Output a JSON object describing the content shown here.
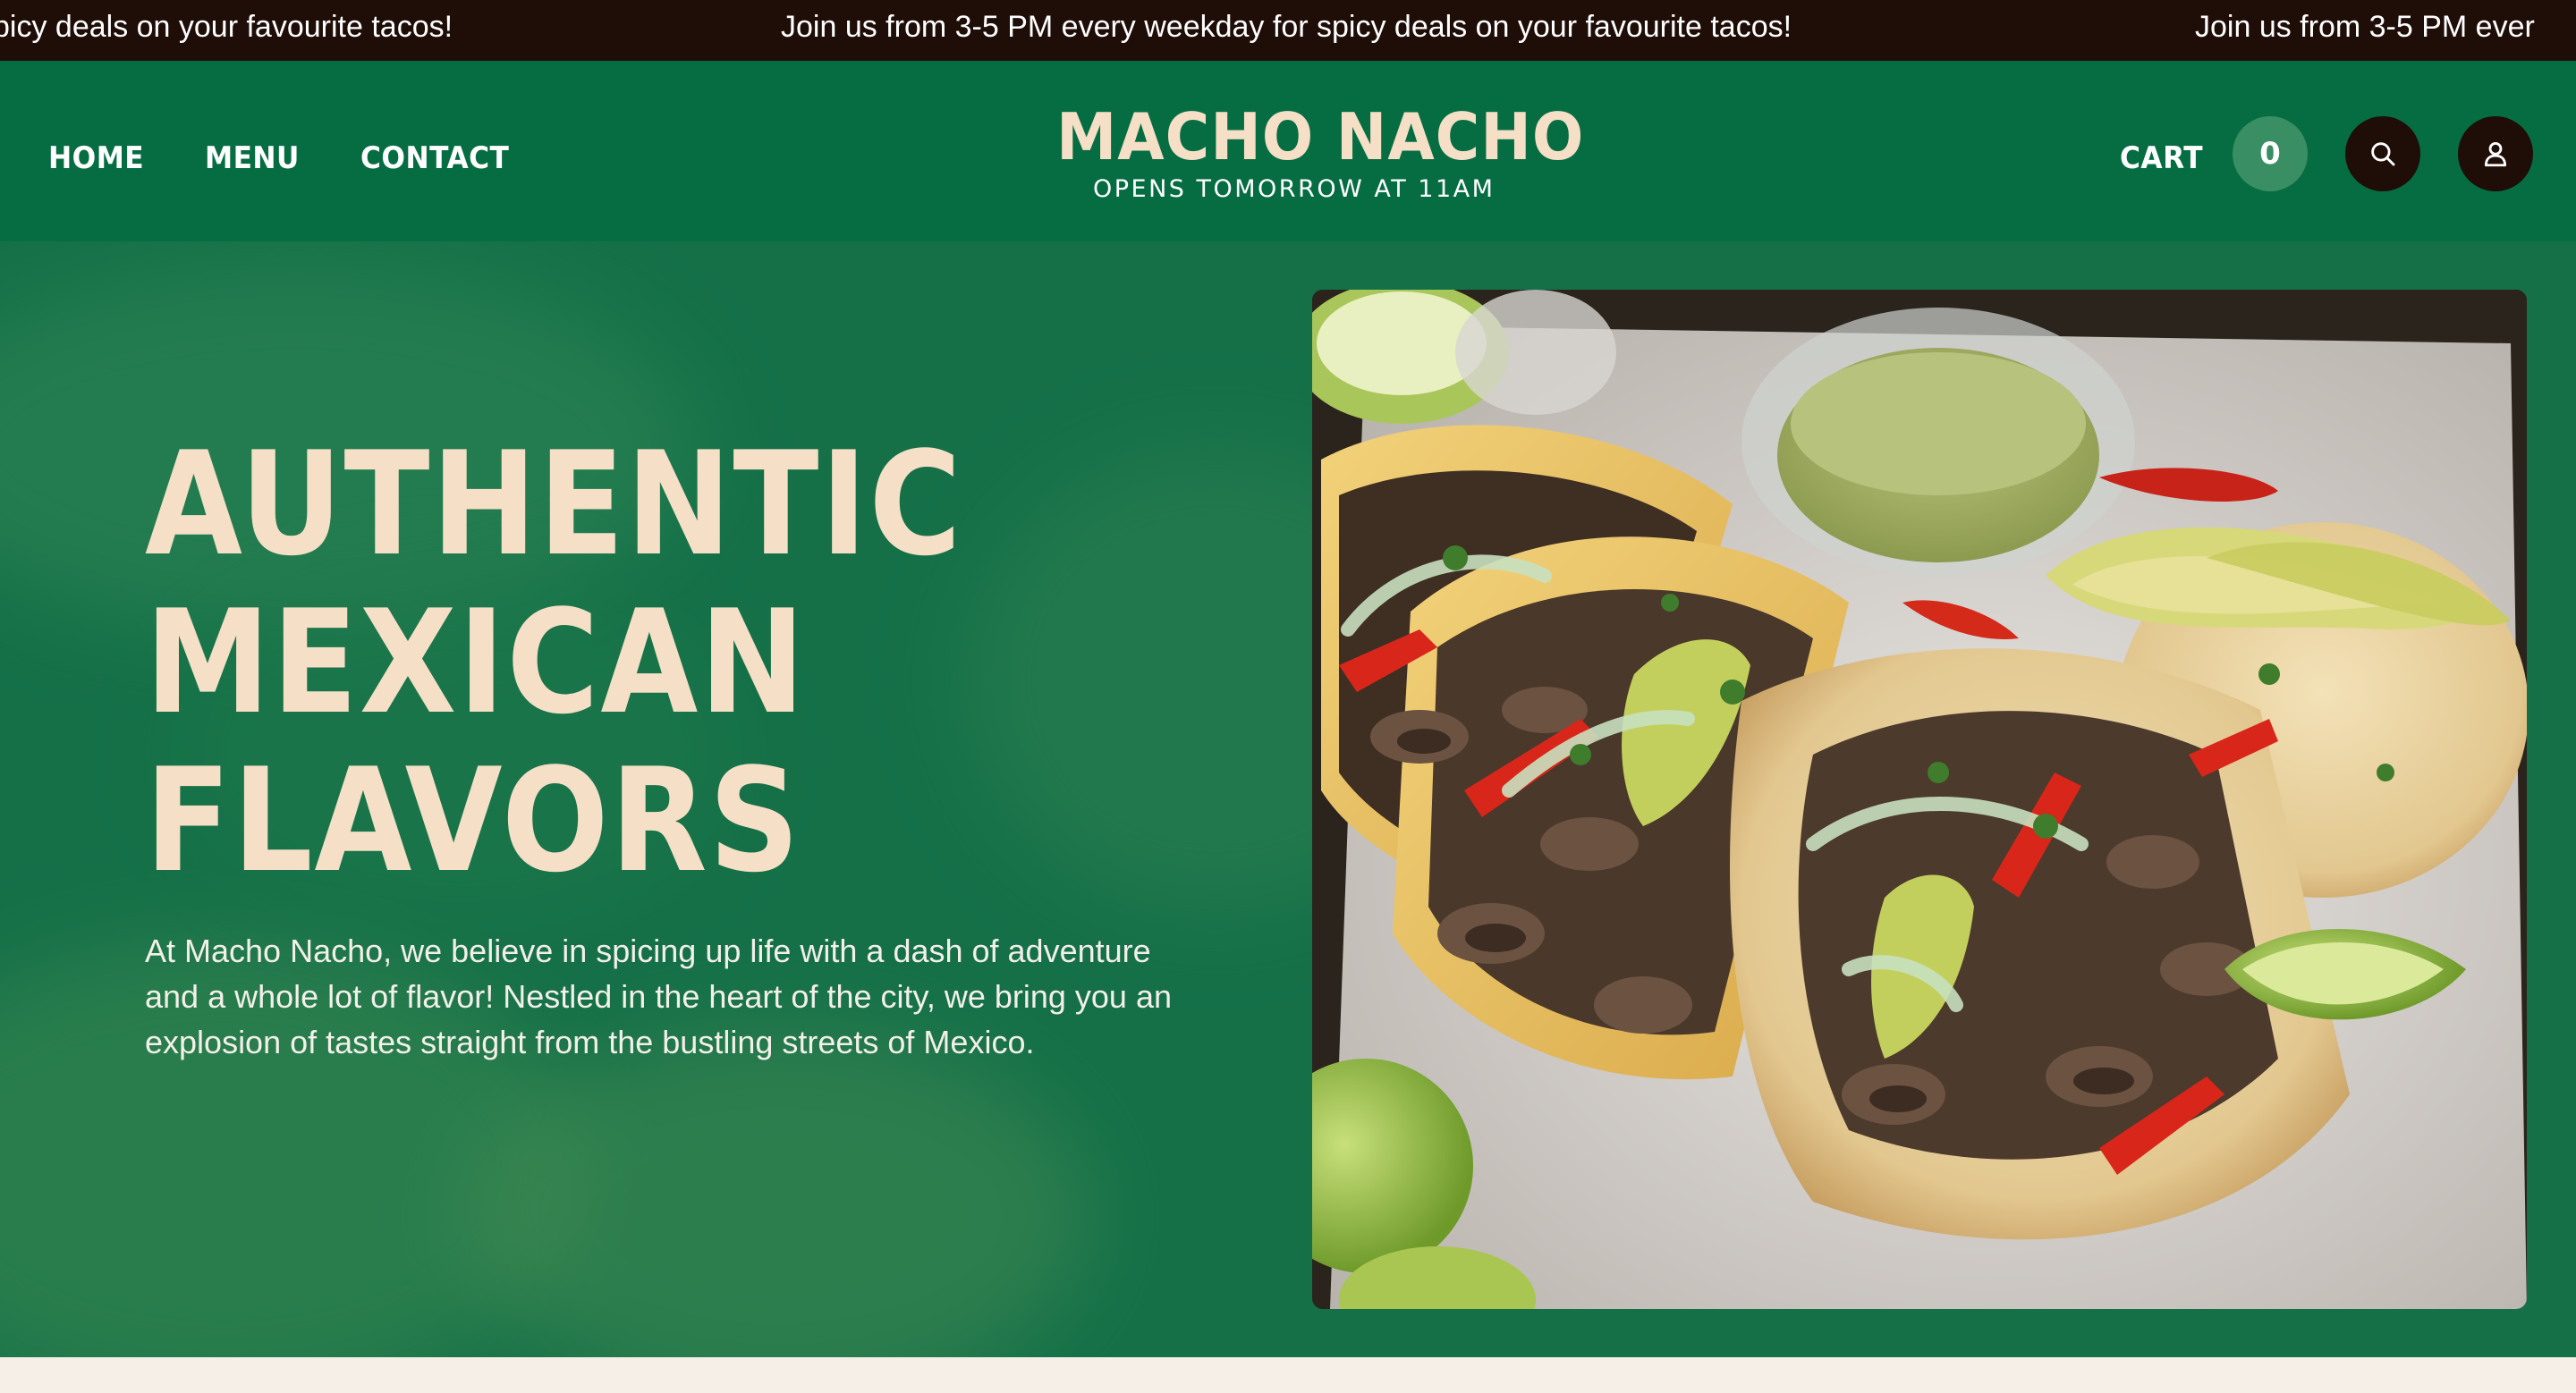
{
  "announcement": {
    "message": "Join us from 3-5 PM every weekday for spicy deals on your favourite tacos!",
    "fragment_left": "picy deals on your favourite tacos!",
    "fragment_right": "Join us from 3-5 PM ever"
  },
  "nav": {
    "home": "HOME",
    "menu": "MENU",
    "contact": "CONTACT"
  },
  "brand": {
    "name": "MACHO NACHO",
    "hours": "OPENS TOMORROW AT 11AM"
  },
  "cart": {
    "label": "CART",
    "count": "0"
  },
  "icons": {
    "search": "search-icon",
    "account": "user-icon"
  },
  "hero": {
    "headline_line1": "AUTHENTIC",
    "headline_line2": "MEXICAN",
    "headline_line3": "FLAVORS",
    "intro": "At Macho Nacho, we believe in spicing up life with a dash of adventure and a whole lot of flavor! Nestled in the heart of the city, we bring you an explosion of tastes straight from the bustling streets of Mexico.",
    "image_subject": "grilled mushroom tacos with avocado, peppers and lime"
  },
  "colors": {
    "ticker_bg": "#1f0d08",
    "header_bg": "#066d43",
    "hero_bg": "#157048",
    "cream": "#f5dfc6",
    "cart_badge": "#3a8e63"
  }
}
